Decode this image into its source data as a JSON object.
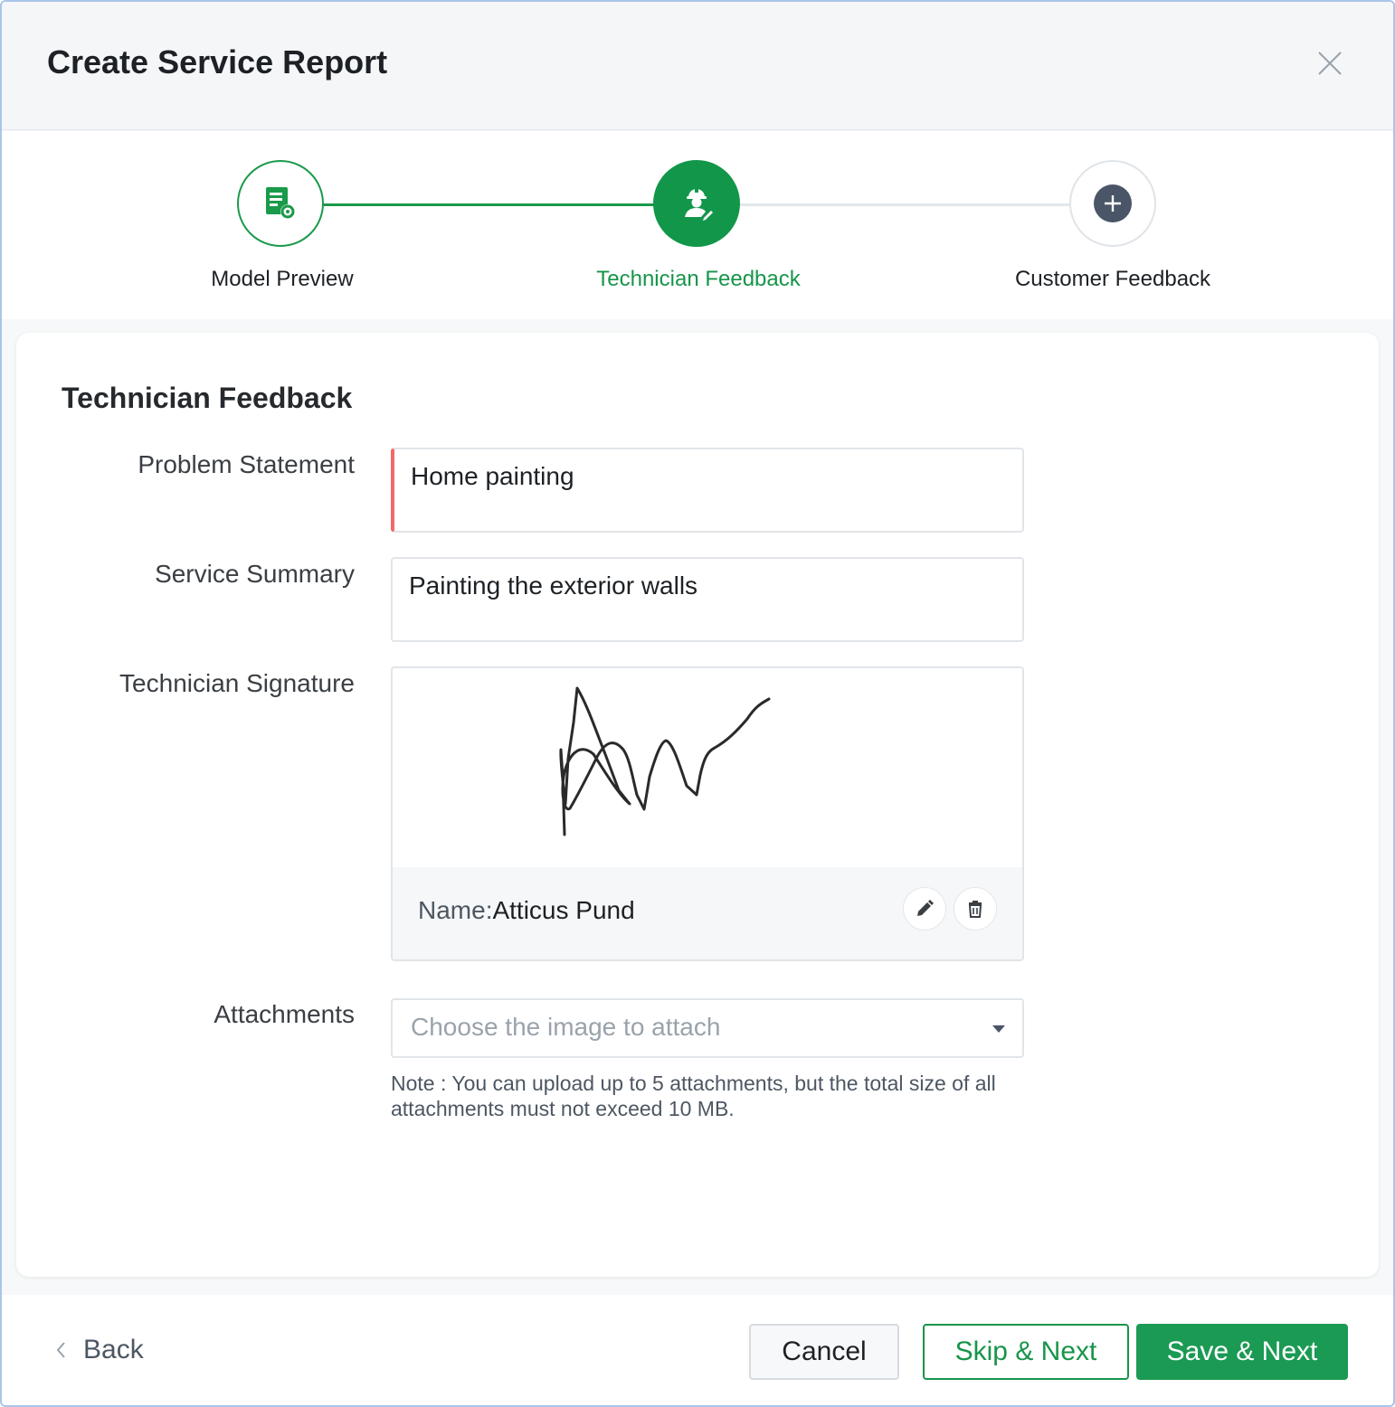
{
  "header": {
    "title": "Create Service Report"
  },
  "stepper": {
    "steps": [
      {
        "label": "Model Preview",
        "icon": "report-settings-icon",
        "state": "done"
      },
      {
        "label": "Technician Feedback",
        "icon": "technician-icon",
        "state": "active"
      },
      {
        "label": "Customer Feedback",
        "icon": "plus-icon",
        "state": "pending"
      }
    ]
  },
  "form": {
    "title": "Technician Feedback",
    "problem_statement": {
      "label": "Problem Statement",
      "value": "Home painting"
    },
    "service_summary": {
      "label": "Service Summary",
      "value": "Painting the exterior walls"
    },
    "technician_signature": {
      "label": "Technician Signature",
      "name_label": "Name:",
      "name": "Atticus Pund"
    },
    "attachments": {
      "label": "Attachments",
      "placeholder": "Choose the image to attach",
      "note": "Note : You can upload up to 5 attachments, but the total size of all attachments must not exceed 10 MB."
    }
  },
  "footer": {
    "back_label": "Back",
    "cancel_label": "Cancel",
    "skip_label": "Skip & Next",
    "save_label": "Save & Next"
  },
  "colors": {
    "accent_green": "#17954a",
    "required_marker": "#ef6b6b",
    "pending_step": "#4a5568"
  }
}
